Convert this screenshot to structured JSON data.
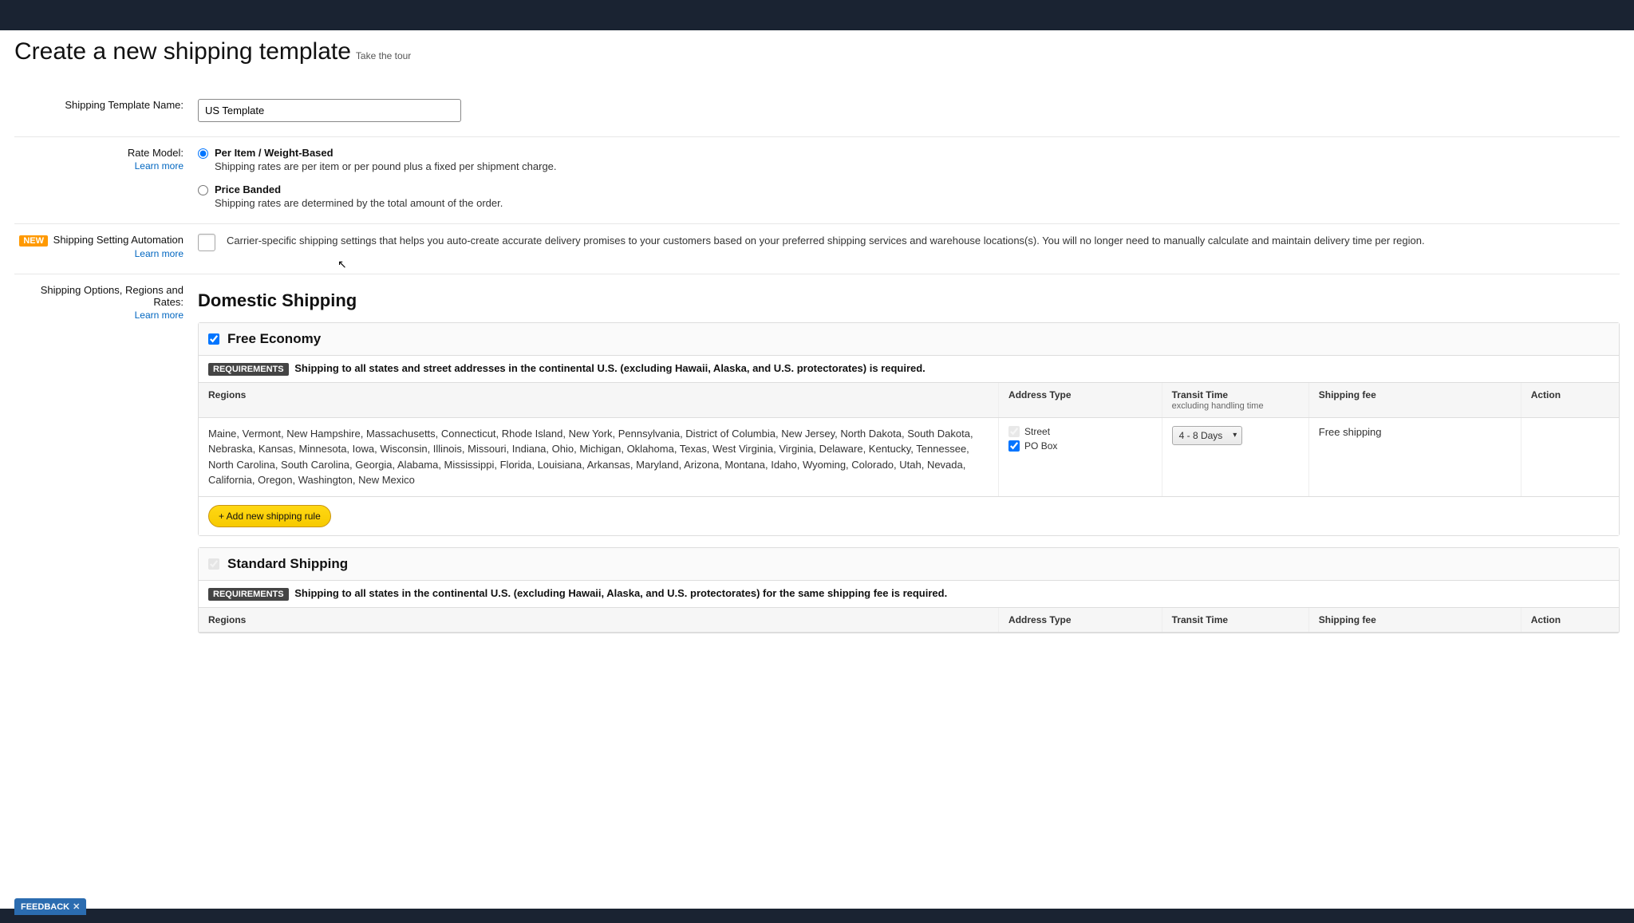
{
  "page_title": "Create a new shipping template",
  "take_tour": "Take the tour",
  "labels": {
    "template_name": "Shipping Template Name:",
    "rate_model": "Rate Model:",
    "learn_more": "Learn more",
    "automation": "Shipping Setting Automation",
    "shipping_options": "Shipping Options, Regions and Rates:",
    "new_badge": "NEW"
  },
  "template_name_value": "US Template",
  "rate_model": {
    "per_item_label": "Per Item / Weight-Based",
    "per_item_desc": "Shipping rates are per item or per pound plus a fixed per shipment charge.",
    "price_banded_label": "Price Banded",
    "price_banded_desc": "Shipping rates are determined by the total amount of the order."
  },
  "automation_desc": "Carrier-specific shipping settings that helps you auto-create accurate delivery promises to your customers based on your preferred shipping services and warehouse locations(s). You will no longer need to manually calculate and maintain delivery time per region.",
  "domestic_heading": "Domestic Shipping",
  "free_economy": {
    "title": "Free Economy",
    "requirements_badge": "REQUIREMENTS",
    "requirements_text": "Shipping to all states and street addresses in the continental U.S. (excluding Hawaii, Alaska, and U.S. protectorates) is required.",
    "columns": {
      "regions": "Regions",
      "address_type": "Address Type",
      "transit_time": "Transit Time",
      "transit_sub": "excluding handling time",
      "shipping_fee": "Shipping fee",
      "action": "Action"
    },
    "regions_text": "Maine, Vermont, New Hampshire, Massachusetts, Connecticut, Rhode Island, New York, Pennsylvania, District of Columbia, New Jersey, North Dakota, South Dakota, Nebraska, Kansas, Minnesota, Iowa, Wisconsin, Illinois, Missouri, Indiana, Ohio, Michigan, Oklahoma, Texas, West Virginia, Virginia, Delaware, Kentucky, Tennessee, North Carolina, South Carolina, Georgia, Alabama, Mississippi, Florida, Louisiana, Arkansas, Maryland, Arizona, Montana, Idaho, Wyoming, Colorado, Utah, Nevada, California, Oregon, Washington, New Mexico",
    "address_types": {
      "street": "Street",
      "po_box": "PO Box"
    },
    "transit_selected": "4 - 8 Days",
    "shipping_fee_value": "Free shipping",
    "add_rule_btn": "+ Add new shipping rule"
  },
  "standard_shipping": {
    "title": "Standard Shipping",
    "requirements_badge": "REQUIREMENTS",
    "requirements_text": "Shipping to all states in the continental U.S. (excluding Hawaii, Alaska, and U.S. protectorates) for the same shipping fee is required.",
    "columns": {
      "regions": "Regions",
      "address_type": "Address Type",
      "transit_time": "Transit Time",
      "shipping_fee": "Shipping fee",
      "action": "Action"
    }
  },
  "feedback": {
    "label": "FEEDBACK",
    "close": "✕"
  }
}
